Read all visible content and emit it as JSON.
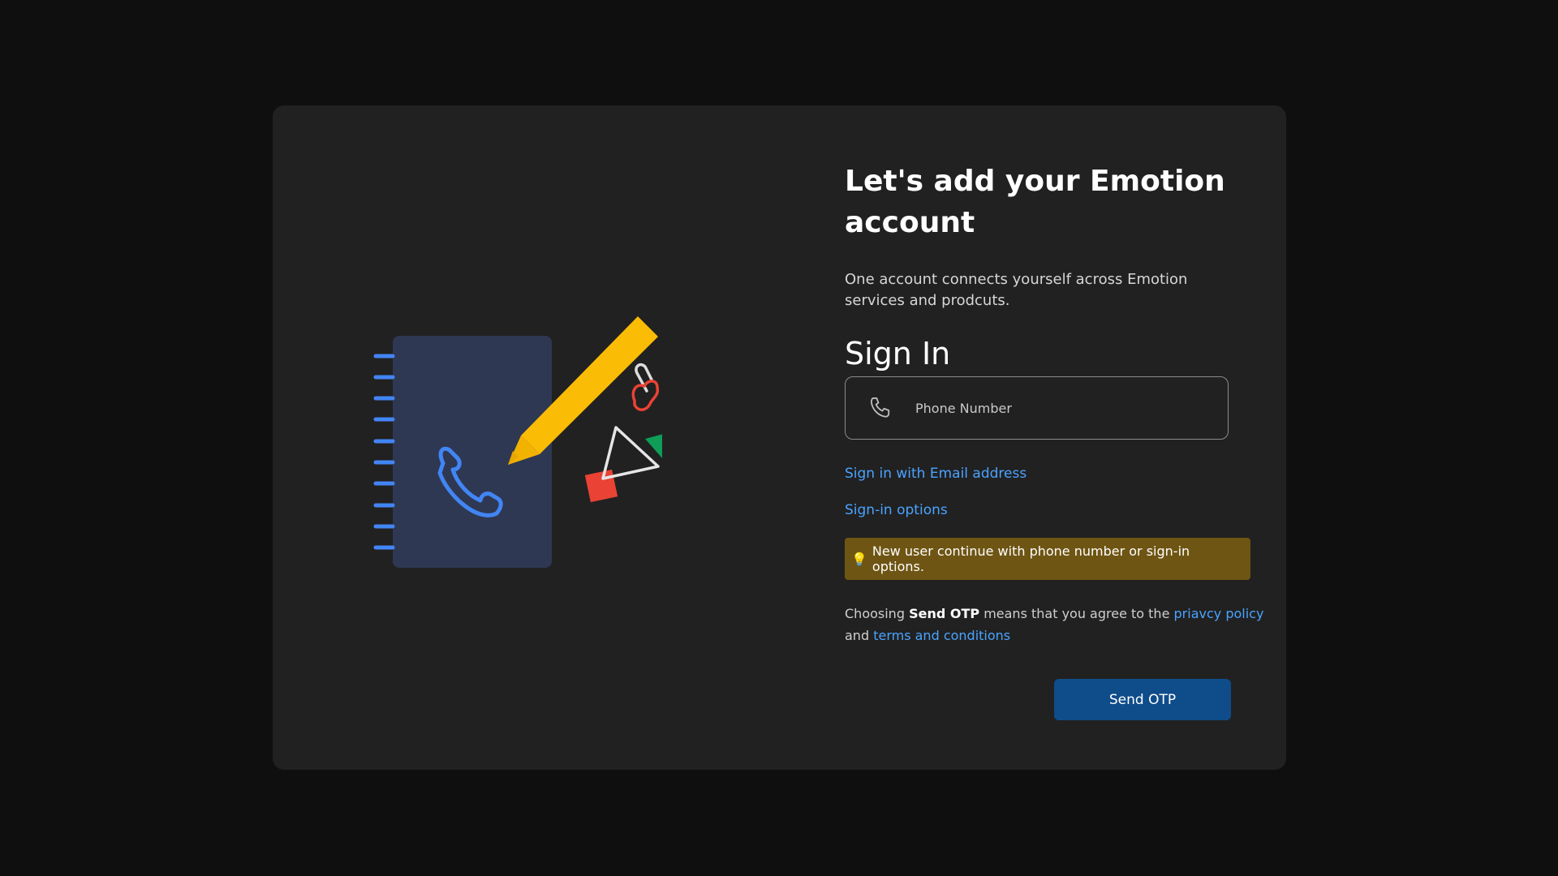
{
  "dialog": {
    "title": "Let's add your Emotion account",
    "subtitle": "One account connects yourself across Emotion services and prodcuts.",
    "signin_heading": "Sign In",
    "phone_input": {
      "placeholder": "Phone Number",
      "value": "",
      "icon": "phone-icon"
    },
    "links": {
      "email": "Sign in with Email address",
      "options": "Sign-in options"
    },
    "notice": {
      "icon": "lightbulb-icon",
      "text": "New user continue with phone number or sign-in options."
    },
    "terms": {
      "prefix": "Choosing",
      "bold": "Send OTP",
      "middle": "means that you agree to the",
      "privacy_link": "priavcy policy",
      "and": "and",
      "terms_link": "terms and conditions"
    },
    "send_button": "Send OTP"
  },
  "illustration": {
    "icons": [
      "notebook-icon",
      "pencil-icon",
      "phone-icon",
      "paperclip-icon",
      "triangle-icon",
      "square-icon"
    ]
  },
  "colors": {
    "background": "#0f0f0f",
    "card": "#212121",
    "link": "#4aa3ff",
    "notice_bg": "#6e5513",
    "primary_button": "#0f4c8a",
    "pencil": "#fbbc05",
    "notebook": "#2e3853",
    "accent_blue": "#4285f4",
    "accent_red": "#ea4335",
    "accent_green": "#0f9d58"
  }
}
